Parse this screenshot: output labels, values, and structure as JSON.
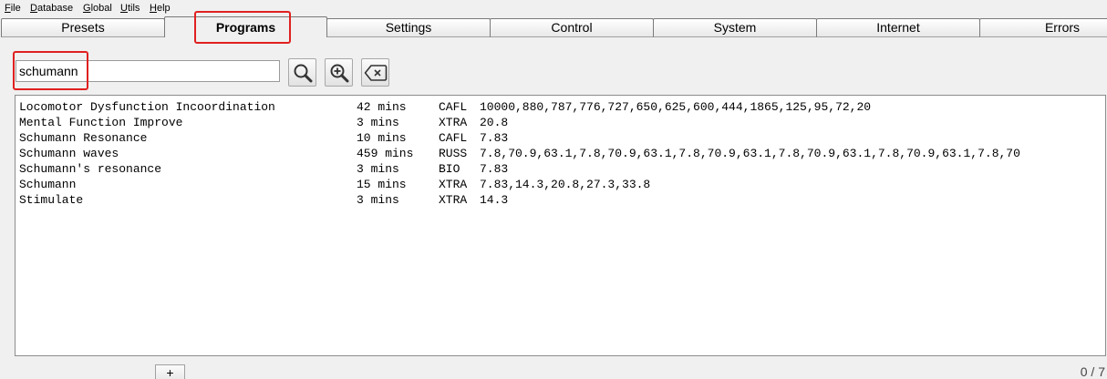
{
  "menu": {
    "items": [
      {
        "mnemonic": "F",
        "rest": "ile"
      },
      {
        "mnemonic": "D",
        "rest": "atabase"
      },
      {
        "mnemonic": "G",
        "rest": "lobal"
      },
      {
        "mnemonic": "U",
        "rest": "tils"
      },
      {
        "mnemonic": "H",
        "rest": "elp"
      }
    ]
  },
  "tabs": [
    {
      "label": "Presets"
    },
    {
      "label": "Programs",
      "active": true
    },
    {
      "label": "Settings"
    },
    {
      "label": "Control"
    },
    {
      "label": "System"
    },
    {
      "label": "Internet"
    },
    {
      "label": "Errors"
    }
  ],
  "search": {
    "value": "schumann"
  },
  "toolbar": {
    "search_icon": "magnifier-icon",
    "zoom_icon": "zoom-in-icon",
    "clear_icon": "backspace-clear-icon"
  },
  "results": [
    {
      "name": "Locomotor Dysfunction Incoordination",
      "duration": "42 mins",
      "source": "CAFL",
      "freqs": "10000,880,787,776,727,650,625,600,444,1865,125,95,72,20"
    },
    {
      "name": "Mental Function Improve",
      "duration": "3 mins",
      "source": "XTRA",
      "freqs": "20.8"
    },
    {
      "name": "Schumann Resonance",
      "duration": "10 mins",
      "source": "CAFL",
      "freqs": "7.83"
    },
    {
      "name": "Schumann waves",
      "duration": "459 mins",
      "source": "RUSS",
      "freqs": "7.8,70.9,63.1,7.8,70.9,63.1,7.8,70.9,63.1,7.8,70.9,63.1,7.8,70.9,63.1,7.8,70"
    },
    {
      "name": "Schumann's resonance",
      "duration": "3 mins",
      "source": "BIO",
      "freqs": "7.83"
    },
    {
      "name": "Schumann",
      "duration": "15 mins",
      "source": "XTRA",
      "freqs": "7.83,14.3,20.8,27.3,33.8"
    },
    {
      "name": "Stimulate",
      "duration": "3 mins",
      "source": "XTRA",
      "freqs": "14.3"
    }
  ],
  "footer": {
    "add_label": "+",
    "count": "0 / 7"
  },
  "colors": {
    "highlight": "#e02020"
  }
}
